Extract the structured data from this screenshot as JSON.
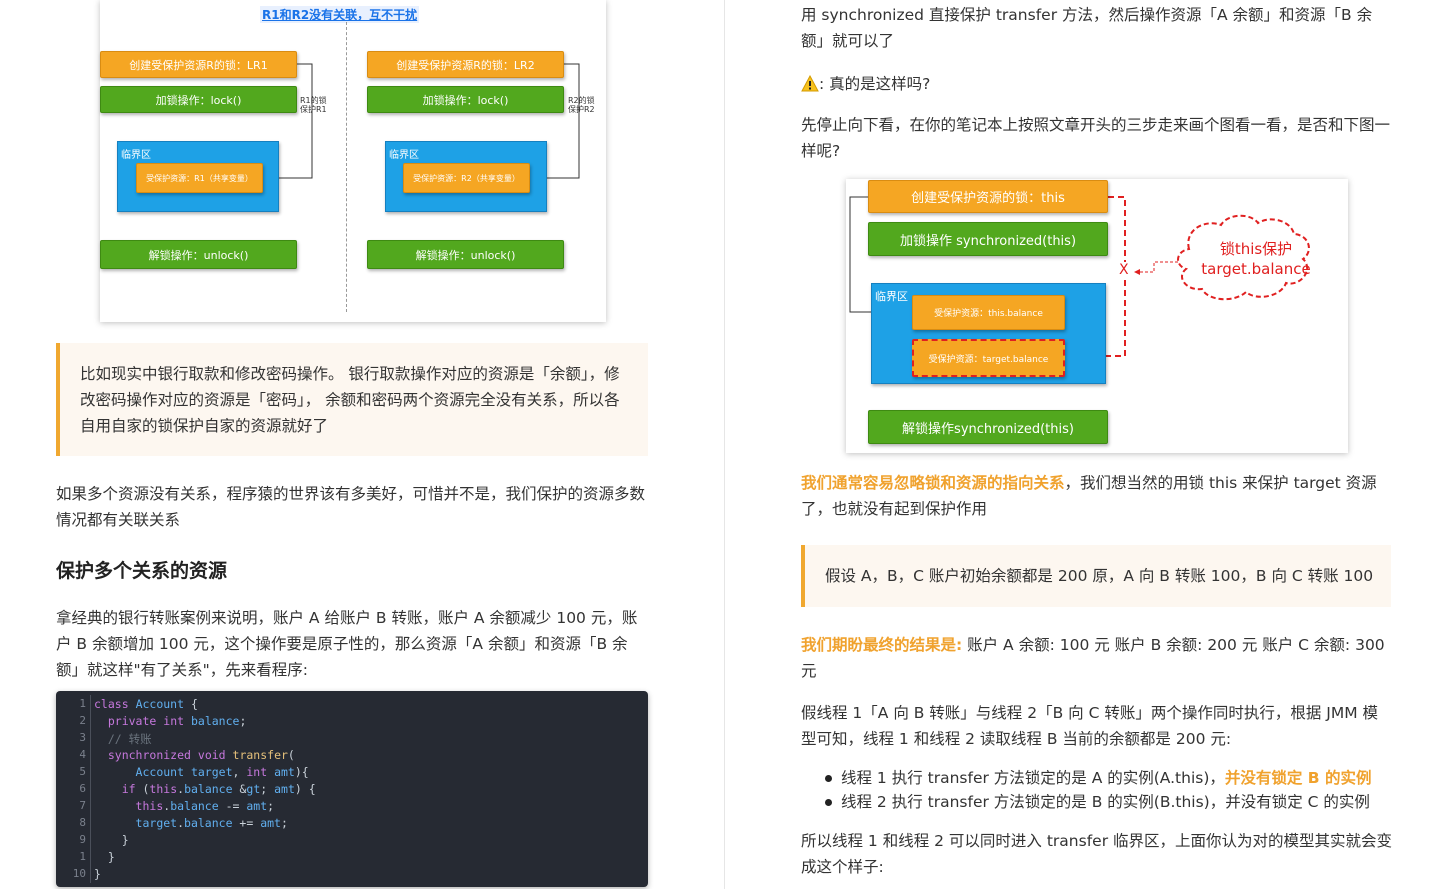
{
  "left": {
    "fig1": {
      "title": "R1和R2没有关联，互不干扰",
      "a": {
        "create_lock": "创建受保护资源R的锁：LR1",
        "lock": "加锁操作：lock()",
        "side_note": "R1的锁\n保护R1",
        "critical": "临界区",
        "resource": "受保护资源：R1（共享变量）",
        "unlock": "解锁操作：unlock()"
      },
      "b": {
        "create_lock": "创建受保护资源R的锁：LR2",
        "lock": "加锁操作：lock()",
        "side_note": "R2的锁\n保护R2",
        "critical": "临界区",
        "resource": "受保护资源：R2（共享变量）",
        "unlock": "解锁操作：unlock()"
      }
    },
    "quote1": "比如现实中银行取款和修改密码操作。 银行取款操作对应的资源是「余额」，修改密码操作对应的资源是「密码」， 余额和密码两个资源完全没有关系，所以各自用自家的锁保护自家的资源就好了",
    "para1": "如果多个资源没有关系，程序猿的世界该有多美好，可惜并不是，我们保护的资源多数情况都有关联关系",
    "heading": "保护多个关系的资源",
    "para2": "拿经典的银行转账案例来说明，账户 A 给账户 B 转账，账户 A 余额减少 100 元，账户 B 余额增加 100 元，这个操作要是原子性的，那么资源「A 余额」和资源「B 余额」就这样\"有了关系\"，先来看程序:",
    "code": {
      "line_numbers": [
        "1",
        "2",
        "3",
        "4",
        "5",
        "6",
        "7",
        "8",
        "9",
        "1",
        "10"
      ],
      "lines": [
        "class Account {",
        "  private int balance;",
        "  // 转账",
        "  synchronized void transfer(",
        "      Account target, int amt){",
        "    if (this.balance > amt) {",
        "      this.balance -= amt;",
        "      target.balance += amt;",
        "    }",
        "  }",
        "}"
      ]
    }
  },
  "right": {
    "para1": "用 synchronized 直接保护 transfer 方法，然后操作资源「A 余额」和资源「B 余额」就可以了",
    "warn_icon": "warning-icon",
    "warn": ": 真的是这样吗?",
    "para2": "先停止向下看，在你的笔记本上按照文章开头的三步走来画个图看一看，是否和下图一样呢?",
    "fig2": {
      "create_lock": "创建受保护资源的锁：this",
      "lock": "加锁操作 synchronized(this)",
      "critical": "临界区",
      "res1": "受保护资源：this.balance",
      "res2": "受保护资源：target.balance",
      "unlock": "解锁操作synchronized(this)",
      "cloud": "锁this保护\ntarget.balance",
      "x_mark": "X"
    },
    "para3_hl": "我们通常容易忽略锁和资源的指向关系",
    "para3": "，我们想当然的用锁 this 来保护 target 资源了，也就没有起到保护作用",
    "quote2": "假设 A，B，C 账户初始余额都是 200 原，A 向 B 转账 100，B 向 C 转账 100",
    "para4_hl": "我们期盼最终的结果是:",
    "para4": " 账户 A 余额: 100 元 账户 B 余额: 200 元 账户 C 余额: 300 元",
    "para5": "假线程 1「A 向 B 转账」与线程 2「B 向 C 转账」两个操作同时执行，根据 JMM 模型可知，线程 1 和线程 2 读取线程 B 当前的余额都是 200 元:",
    "bullets": [
      {
        "text": "线程 1 执行 transfer 方法锁定的是 A 的实例(A.this)，",
        "hl": "并没有锁定 B 的实例"
      },
      {
        "text": "线程 2 执行 transfer 方法锁定的是 B 的实例(B.this)，并没有锁定 C 的实例",
        "hl": ""
      }
    ],
    "para6": "所以线程 1 和线程 2 可以同时进入 transfer 临界区，上面你认为对的模型其实就会变成这个样子:"
  },
  "colors": {
    "accent": "#f0a22e",
    "orange_box": "#f5a623",
    "green_box": "#52a81e",
    "blue_box": "#1ea1e6",
    "red_dash": "#e02020",
    "code_bg": "#262a33"
  }
}
